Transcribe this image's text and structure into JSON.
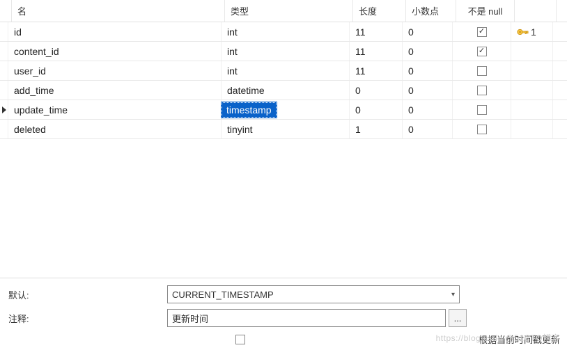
{
  "headers": {
    "name": "名",
    "type": "类型",
    "length": "长度",
    "decimals": "小数点",
    "notnull": "不是 null"
  },
  "rows": [
    {
      "name": "id",
      "type": "int",
      "length": "11",
      "decimals": "0",
      "notnull": true,
      "primary": true,
      "keyIndex": "1",
      "active": false
    },
    {
      "name": "content_id",
      "type": "int",
      "length": "11",
      "decimals": "0",
      "notnull": true,
      "primary": false,
      "keyIndex": "",
      "active": false
    },
    {
      "name": "user_id",
      "type": "int",
      "length": "11",
      "decimals": "0",
      "notnull": false,
      "primary": false,
      "keyIndex": "",
      "active": false
    },
    {
      "name": "add_time",
      "type": "datetime",
      "length": "0",
      "decimals": "0",
      "notnull": false,
      "primary": false,
      "keyIndex": "",
      "active": false
    },
    {
      "name": "update_time",
      "type": "timestamp",
      "length": "0",
      "decimals": "0",
      "notnull": false,
      "primary": false,
      "keyIndex": "",
      "active": true
    },
    {
      "name": "deleted",
      "type": "tinyint",
      "length": "1",
      "decimals": "0",
      "notnull": false,
      "primary": false,
      "keyIndex": "",
      "active": false
    }
  ],
  "details": {
    "default_label": "默认:",
    "default_value": "CURRENT_TIMESTAMP",
    "comment_label": "注释:",
    "comment_value": "更新时间",
    "oncurrent_label": "根据当前时间戳更新",
    "oncurrent_checked": false
  },
  "watermark": "https://blog.csdn @51CTO博客"
}
